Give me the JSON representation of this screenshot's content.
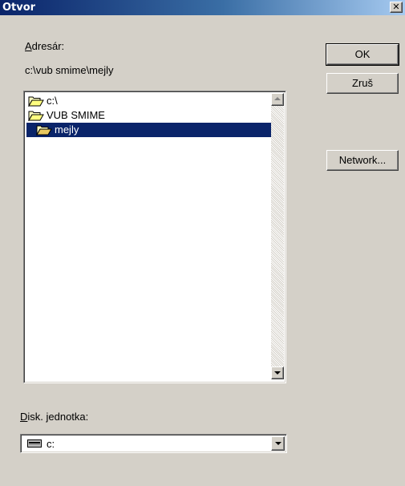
{
  "window": {
    "title": "Otvor",
    "close_glyph": "✕"
  },
  "directory": {
    "label_accel": "A",
    "label_rest": "dresár:",
    "path": "c:\\vub smime\\mejly"
  },
  "folders": [
    {
      "name": "c:\\",
      "icon": "open-folder-icon",
      "selected": false
    },
    {
      "name": "VUB SMIME",
      "icon": "open-folder-icon",
      "selected": false
    },
    {
      "name": "mejly",
      "icon": "open-folder-icon",
      "selected": true
    }
  ],
  "drive": {
    "label_accel": "D",
    "label_rest": "isk. jednotka:",
    "value": "c:",
    "icon": "drive-icon"
  },
  "buttons": {
    "ok": "OK",
    "cancel": "Zruš",
    "network": "Network..."
  }
}
